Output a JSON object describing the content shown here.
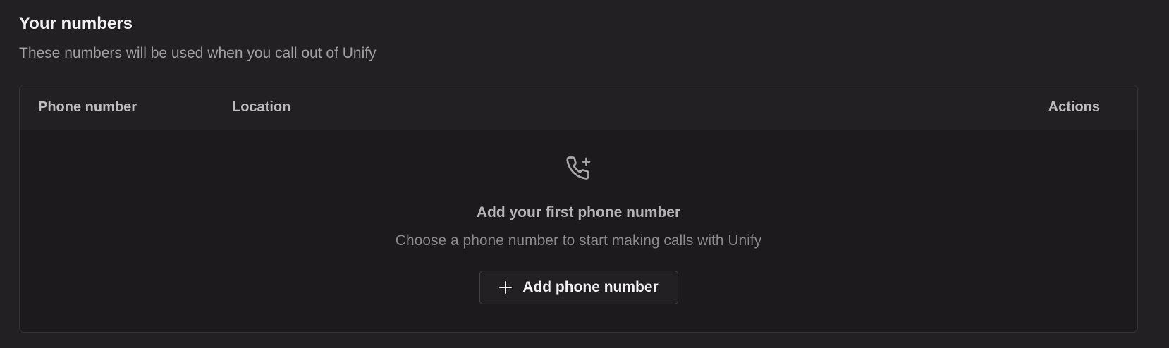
{
  "section": {
    "title": "Your numbers",
    "subtitle": "These numbers will be used when you call out of Unify"
  },
  "table": {
    "columns": [
      "Phone number",
      "Location",
      "Actions"
    ],
    "rows": []
  },
  "empty_state": {
    "icon": "phone-plus-icon",
    "title": "Add your first phone number",
    "description": "Choose a phone number to start making calls with Unify",
    "button": {
      "icon": "plus-icon",
      "label": "Add phone number"
    }
  },
  "colors": {
    "background": "#222022",
    "card_background": "#1c1a1c",
    "border": "#353336",
    "text_primary": "#f3f2f3",
    "text_secondary": "#a19fa2"
  }
}
